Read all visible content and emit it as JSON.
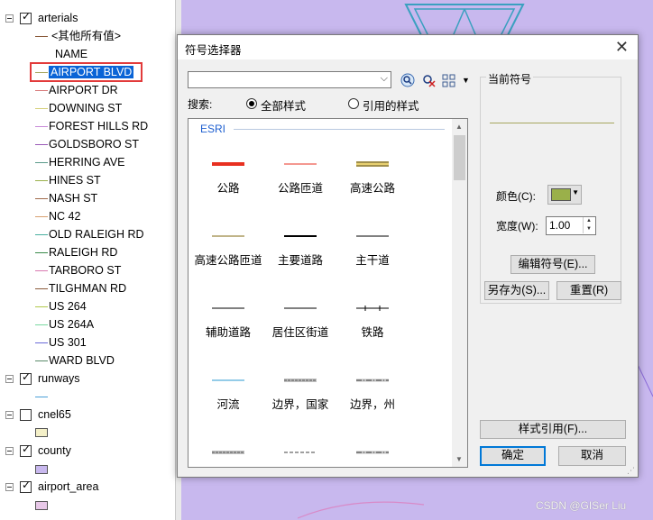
{
  "toc": {
    "layers": [
      {
        "name": "arterials",
        "checked": true
      },
      {
        "name": "runways",
        "checked": true
      },
      {
        "name": "cnel65",
        "checked": false
      },
      {
        "name": "county",
        "checked": true
      },
      {
        "name": "airport_area",
        "checked": true
      }
    ],
    "arterials_items": {
      "other_values": "<其他所有值>",
      "field_name": "NAME",
      "values": [
        {
          "label": "AIRPORT BLVD",
          "color": "#a6a660"
        },
        {
          "label": "AIRPORT DR",
          "color": "#d87a7a"
        },
        {
          "label": "DOWNING ST",
          "color": "#d6d07a"
        },
        {
          "label": "FOREST HILLS RD",
          "color": "#c88ad8"
        },
        {
          "label": "GOLDSBORO ST",
          "color": "#9a5ab8"
        },
        {
          "label": "HERRING AVE",
          "color": "#5a9a8a"
        },
        {
          "label": "HINES ST",
          "color": "#9ab04a"
        },
        {
          "label": "NASH ST",
          "color": "#a06a4a"
        },
        {
          "label": "NC 42",
          "color": "#d8a070"
        },
        {
          "label": "OLD RALEIGH RD",
          "color": "#4ab0a0"
        },
        {
          "label": "RALEIGH RD",
          "color": "#3a8a4a"
        },
        {
          "label": "TARBORO ST",
          "color": "#d87ab0"
        },
        {
          "label": "TILGHMAN RD",
          "color": "#8a5a3a"
        },
        {
          "label": "US 264",
          "color": "#b0c84a"
        },
        {
          "label": "US 264A",
          "color": "#7ad8a0"
        },
        {
          "label": "US 301",
          "color": "#6a6ad8"
        },
        {
          "label": "WARD BLVD",
          "color": "#5a8a6a"
        }
      ]
    },
    "runways_legend_color": "#4aa0d8",
    "cnel65_legend_color": "#f4f0c8",
    "county_legend_color": "#c8b8ee",
    "airport_area_legend_color": "#e8c8e8"
  },
  "dialog": {
    "title": "符号选择器",
    "close_glyph": "✕",
    "search": {
      "value": "",
      "label": "搜索:",
      "option_all": "全部样式",
      "option_referenced": "引用的样式"
    },
    "group_name": "ESRI",
    "symbols": [
      {
        "label": "公路",
        "color": "#e83020",
        "style": "thick"
      },
      {
        "label": "公路匝道",
        "color": "#e83020",
        "style": "thin"
      },
      {
        "label": "高速公路",
        "color": "#806a10",
        "style": "double"
      },
      {
        "label": "高速公路匝道",
        "color": "#806a10",
        "style": "thin"
      },
      {
        "label": "主要道路",
        "color": "#000000",
        "style": "medium"
      },
      {
        "label": "主干道",
        "color": "#000000",
        "style": "thin"
      },
      {
        "label": "辅助道路",
        "color": "#000000",
        "style": "thin"
      },
      {
        "label": "居住区街道",
        "color": "#000000",
        "style": "thin"
      },
      {
        "label": "铁路",
        "color": "#000000",
        "style": "rail"
      },
      {
        "label": "河流",
        "color": "#2a9ad0",
        "style": "thin"
      },
      {
        "label": "边界，国家",
        "color": "#808080",
        "style": "border"
      },
      {
        "label": "边界，州",
        "color": "#808080",
        "style": "dashdot"
      },
      {
        "label": "",
        "color": "#808080",
        "style": "border"
      },
      {
        "label": "",
        "color": "#808080",
        "style": "dashed"
      },
      {
        "label": "",
        "color": "#808080",
        "style": "dashdot"
      }
    ],
    "current_symbol": {
      "group_label": "当前符号",
      "color_label": "颜色(C):",
      "color_value": "#9ab04a",
      "width_label": "宽度(W):",
      "width_value": "1.00",
      "edit_button": "编辑符号(E)...",
      "save_as_button": "另存为(S)...",
      "reset_button": "重置(R)"
    },
    "style_ref_button": "样式引用(F)...",
    "ok_button": "确定",
    "cancel_button": "取消"
  },
  "watermark": "CSDN @GISer Liu"
}
